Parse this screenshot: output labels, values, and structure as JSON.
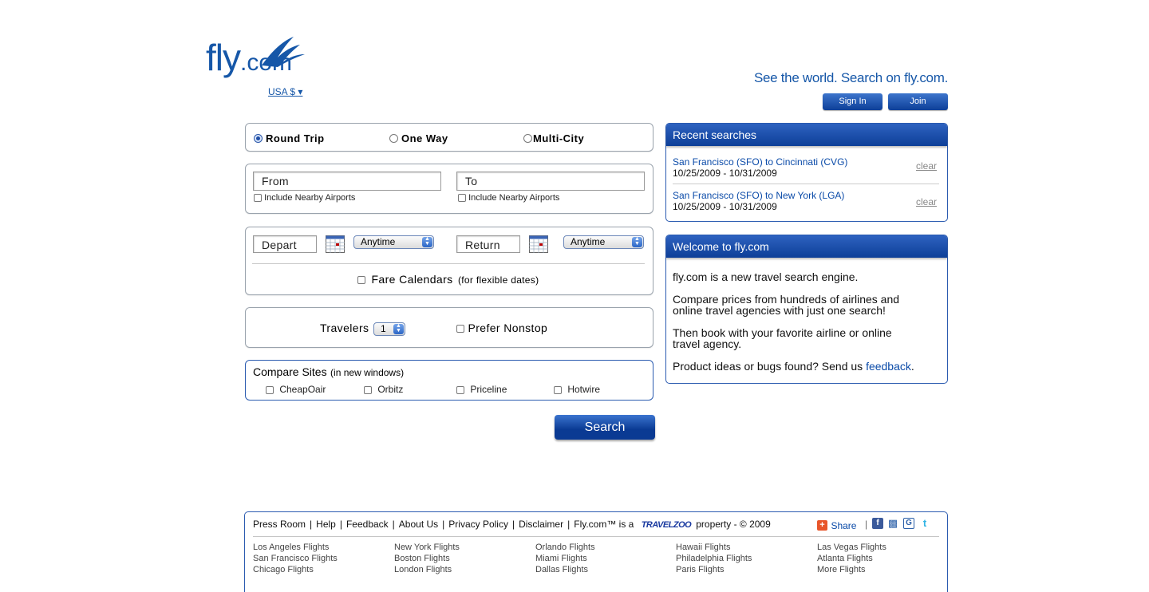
{
  "header": {
    "logo_text": "fly",
    "logo_suffix": ".com",
    "currency": "USA $",
    "tagline": "See the world. Search on fly.com.",
    "sign_in": "Sign In",
    "join": "Join"
  },
  "trip_type": {
    "options": [
      "Round Trip",
      "One Way",
      "Multi-City"
    ],
    "selected": "Round Trip"
  },
  "locations": {
    "from_placeholder": "From",
    "to_placeholder": "To",
    "nearby_label": "Include Nearby Airports"
  },
  "dates": {
    "depart_placeholder": "Depart",
    "return_placeholder": "Return",
    "depart_time": "Anytime",
    "return_time": "Anytime",
    "fare_calendars": "Fare Calendars",
    "fare_calendars_note": "(for flexible dates)"
  },
  "travelers": {
    "label": "Travelers",
    "count": "1",
    "prefer_nonstop": "Prefer Nonstop"
  },
  "compare": {
    "title": "Compare Sites",
    "note": "(in new windows)",
    "sites": [
      "CheapOair",
      "Orbitz",
      "Priceline",
      "Hotwire"
    ]
  },
  "search_button": "Search",
  "recent": {
    "title": "Recent searches",
    "items": [
      {
        "route": "San Francisco (SFO) to Cincinnati (CVG)",
        "dates": "10/25/2009 - 10/31/2009",
        "clear": "clear"
      },
      {
        "route": "San Francisco (SFO) to New York (LGA)",
        "dates": "10/25/2009 - 10/31/2009",
        "clear": "clear"
      }
    ]
  },
  "welcome": {
    "title": "Welcome to fly.com",
    "p1": "fly.com is a new travel search engine.",
    "p2a": "Compare prices from hundreds of airlines and",
    "p2b": "online travel agencies with just one search!",
    "p3a": "Then book with your favorite airline or online",
    "p3b": "travel agency.",
    "p4": "Product ideas or bugs found? Send us",
    "p4_link": "feedback",
    "p4_end": "."
  },
  "footer": {
    "links": [
      "Press Room",
      "Help",
      "Feedback",
      "About Us",
      "Privacy Policy",
      "Disclaimer"
    ],
    "property_pre": "Fly.com™ is a",
    "travelzoo": "TRAVELZOO",
    "property_post": "property - © 2009",
    "share": "Share",
    "city_columns": [
      [
        "Los Angeles Flights",
        "San Francisco Flights",
        "Chicago Flights"
      ],
      [
        "New York Flights",
        "Boston Flights",
        "London Flights"
      ],
      [
        "Orlando Flights",
        "Miami Flights",
        "Dallas Flights"
      ],
      [
        "Hawaii Flights",
        "Philadelphia Flights",
        "Paris Flights"
      ],
      [
        "Las Vegas Flights",
        "Atlanta Flights",
        "More Flights"
      ]
    ]
  }
}
